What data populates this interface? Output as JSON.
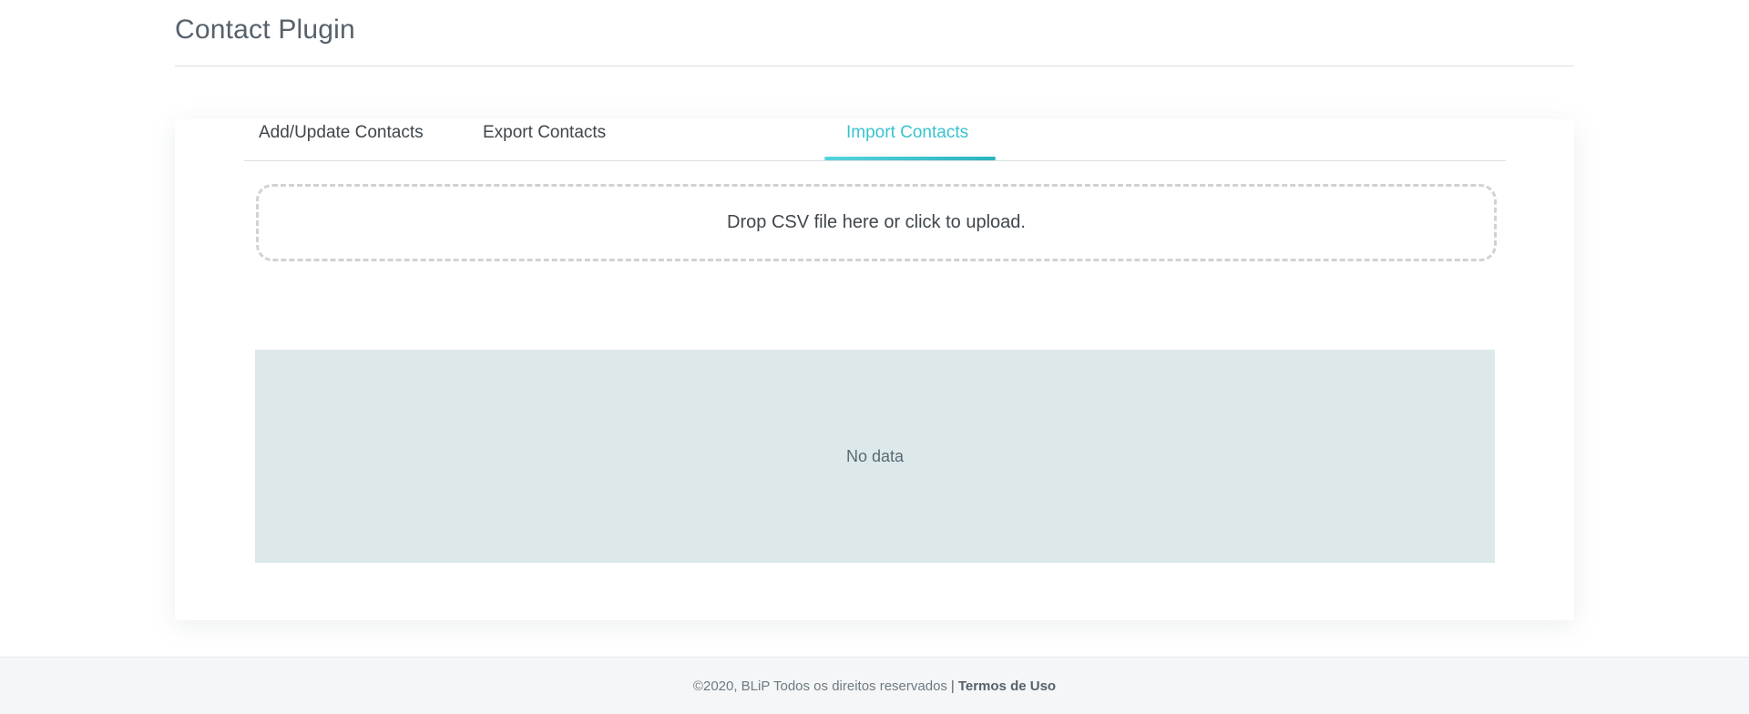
{
  "header": {
    "title": "Contact Plugin"
  },
  "tabs": [
    {
      "label": "Add/Update Contacts",
      "active": false
    },
    {
      "label": "Export Contacts",
      "active": false
    },
    {
      "label": "Import Contacts",
      "active": true
    }
  ],
  "colors": {
    "accent": "#38c3cf",
    "data_area_bg": "#dde8ea"
  },
  "upload": {
    "label": "Drop CSV file here or click to upload."
  },
  "table": {
    "empty_text": "No data"
  },
  "footer": {
    "copyright": "©2020, BLiP Todos os direitos reservados",
    "separator": "|",
    "terms_label": "Termos de Uso"
  }
}
